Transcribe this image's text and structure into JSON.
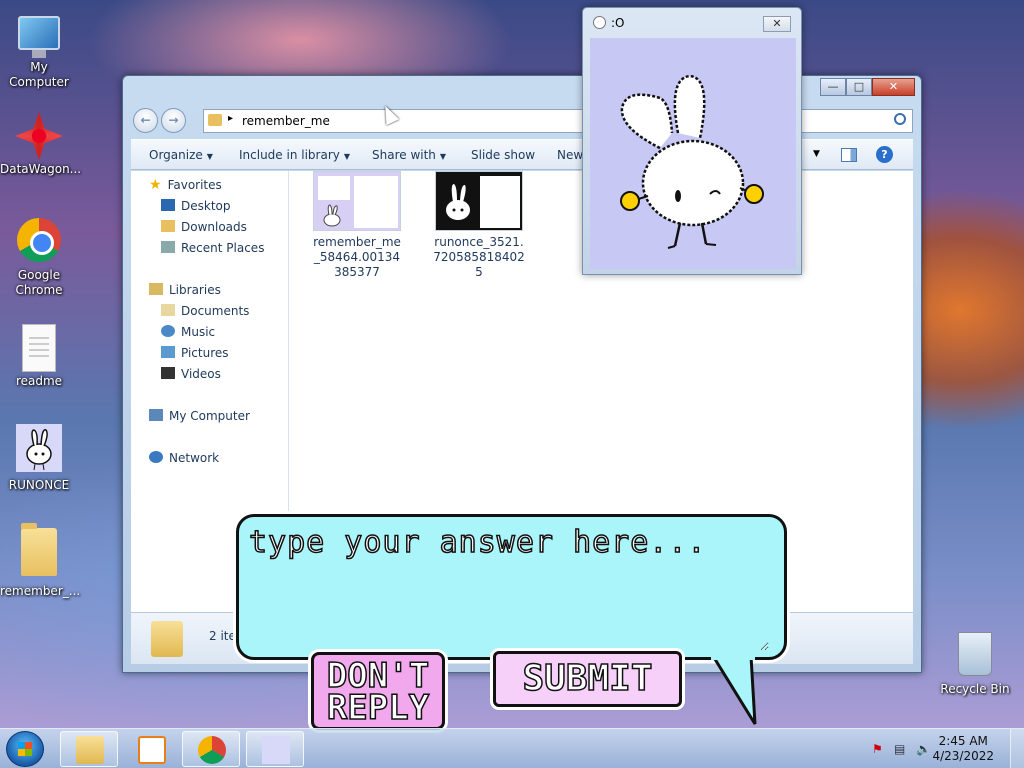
{
  "desktop": {
    "icons": [
      {
        "label": "My Computer",
        "icon": "computer-icon"
      },
      {
        "label": "DataWagon...",
        "icon": "datawagon-icon"
      },
      {
        "label": "Google Chrome",
        "icon": "chrome-icon"
      },
      {
        "label": "readme",
        "icon": "text-file-icon"
      },
      {
        "label": "RUNONCE",
        "icon": "bunny-icon"
      },
      {
        "label": "remember_...",
        "icon": "folder-icon"
      },
      {
        "label": "Recycle Bin",
        "icon": "recycle-bin-icon"
      }
    ]
  },
  "explorer": {
    "address": "remember_me",
    "search_placeholder": "",
    "toolbar": {
      "organize": "Organize",
      "include": "Include in library",
      "share": "Share with",
      "slideshow": "Slide show",
      "new": "New"
    },
    "nav": {
      "favorites": "Favorites",
      "desktop": "Desktop",
      "downloads": "Downloads",
      "recent": "Recent Places",
      "libraries": "Libraries",
      "documents": "Documents",
      "music": "Music",
      "pictures": "Pictures",
      "videos": "Videos",
      "computer": "My Computer",
      "network": "Network"
    },
    "files": [
      {
        "name": "remember_me_58464.00134385377"
      },
      {
        "name": "runonce_3521.7205858184025"
      }
    ],
    "status": "2 ite"
  },
  "bunny_window": {
    "title": ":O",
    "close": "✕"
  },
  "dialog": {
    "prompt": "type your answer here...",
    "answer": "",
    "dont_reply": "DON'T REPLY",
    "submit": "SUBMIT"
  },
  "taskbar": {
    "time": "2:45 AM",
    "date": "4/23/2022"
  },
  "colors": {
    "bubble": "#aaf5fa",
    "dont_button": "#f2a8ec",
    "submit_button": "#f6d0f8",
    "bunny_bg": "#c8c8f4"
  }
}
